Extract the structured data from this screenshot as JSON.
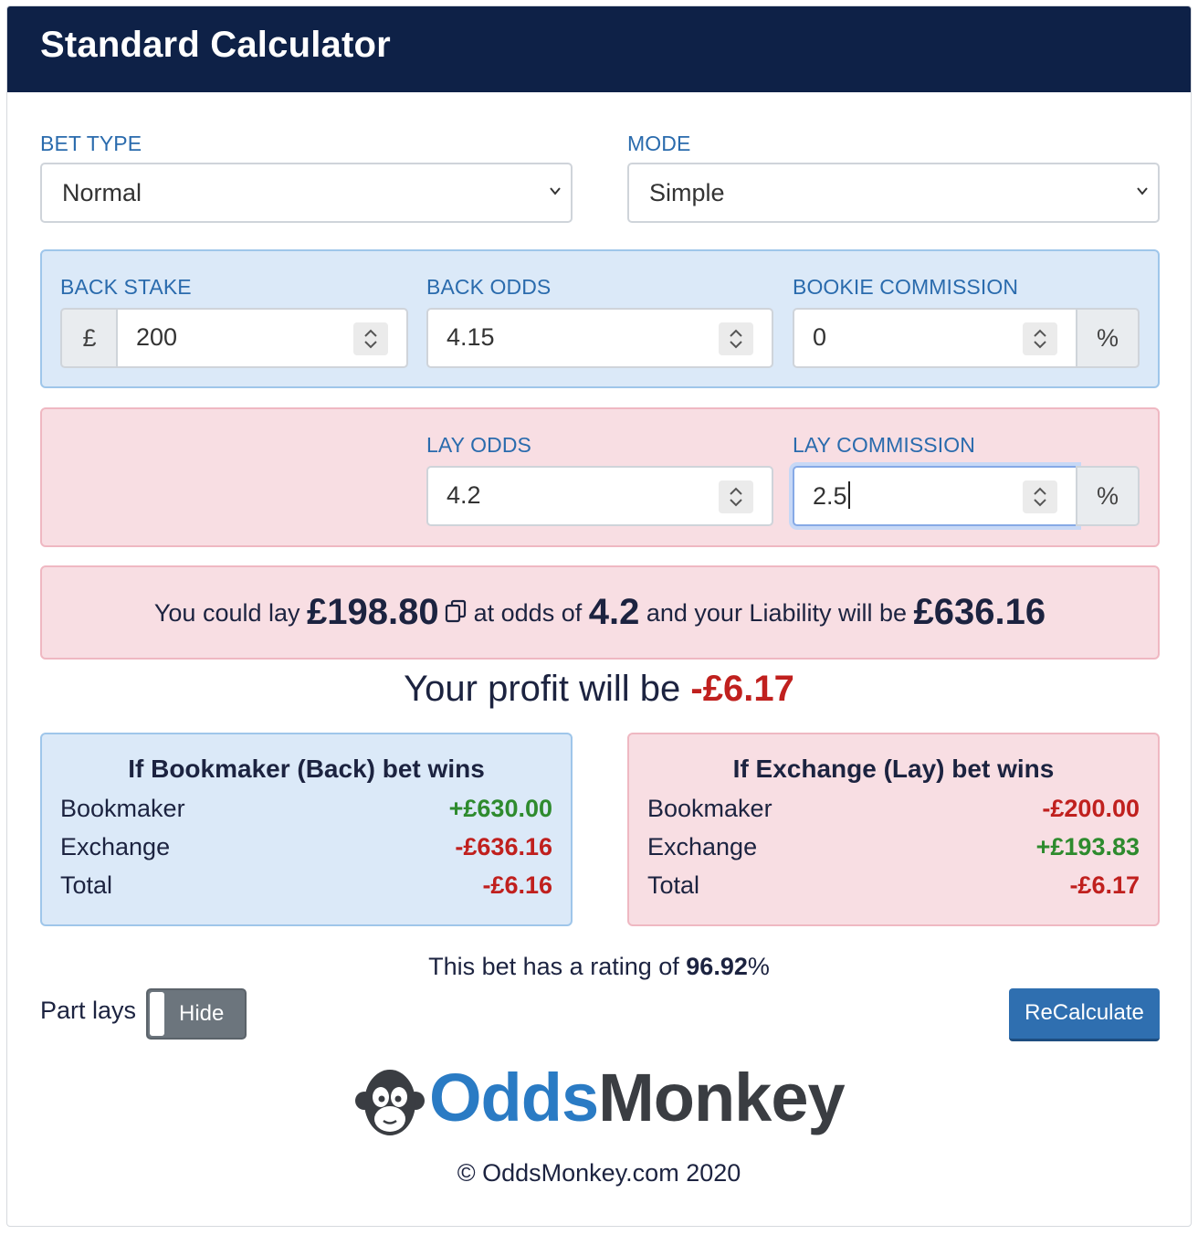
{
  "header": {
    "title": "Standard Calculator"
  },
  "bet_type": {
    "label": "BET TYPE",
    "value": "Normal"
  },
  "mode": {
    "label": "MODE",
    "value": "Simple"
  },
  "back": {
    "stake_label": "BACK STAKE",
    "currency": "£",
    "stake": "200",
    "odds_label": "BACK ODDS",
    "odds": "4.15",
    "commission_label": "BOOKIE COMMISSION",
    "commission": "0",
    "percent": "%"
  },
  "lay": {
    "odds_label": "LAY ODDS",
    "odds": "4.2",
    "commission_label": "LAY COMMISSION",
    "commission": "2.5",
    "percent": "%"
  },
  "result": {
    "t1": "You could lay",
    "lay_amount": "£198.80",
    "t2": "at odds of",
    "lay_odds": "4.2",
    "t3": "and your Liability will be",
    "liability": "£636.16"
  },
  "profit": {
    "text": "Your profit will be",
    "value": "-£6.17"
  },
  "back_wins": {
    "title": "If Bookmaker (Back) bet wins",
    "rows": [
      {
        "label": "Bookmaker",
        "value": "+£630.00"
      },
      {
        "label": "Exchange",
        "value": "-£636.16"
      },
      {
        "label": "Total",
        "value": "-£6.16"
      }
    ]
  },
  "lay_wins": {
    "title": "If Exchange (Lay) bet wins",
    "rows": [
      {
        "label": "Bookmaker",
        "value": "-£200.00"
      },
      {
        "label": "Exchange",
        "value": "+£193.83"
      },
      {
        "label": "Total",
        "value": "-£6.17"
      }
    ]
  },
  "rating": {
    "text": "This bet has a rating of",
    "value": "96.92",
    "suffix": "%"
  },
  "part_lays": {
    "label": "Part lays",
    "toggle": "Hide"
  },
  "recalculate_label": "ReCalculate",
  "logo": {
    "odds": "Odds",
    "monkey": "Monkey"
  },
  "footer": "© OddsMonkey.com 2020",
  "colors": {
    "navy": "#0e2147",
    "label_blue": "#2a6bad",
    "positive": "#2e8b2e",
    "negative": "#c0201e",
    "button": "#2f6fb0"
  }
}
